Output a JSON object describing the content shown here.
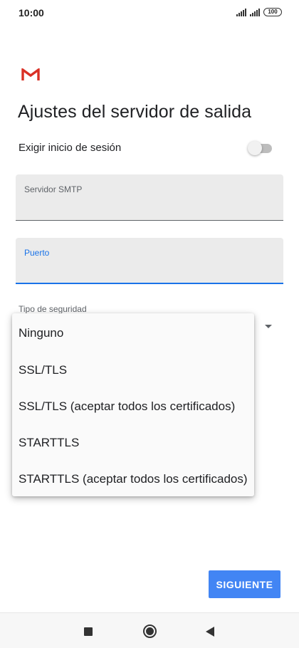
{
  "status_bar": {
    "time": "10:00",
    "battery": "100",
    "icons": [
      "signal-icon",
      "signal-icon",
      "battery-icon"
    ]
  },
  "header": {
    "logo": "gmail-logo",
    "title": "Ajustes del servidor de salida"
  },
  "form": {
    "require_login_label": "Exigir inicio de sesión",
    "require_login_enabled": false,
    "smtp_field": {
      "label": "Servidor SMTP",
      "value": ""
    },
    "port_field": {
      "label": "Puerto",
      "value": ""
    },
    "security_label": "Tipo de seguridad"
  },
  "security_dropdown": {
    "options": [
      "Ninguno",
      "SSL/TLS",
      "SSL/TLS (aceptar todos los certificados)",
      "STARTTLS",
      "STARTTLS (aceptar todos los certificados)"
    ]
  },
  "actions": {
    "next_label": "SIGUIENTE"
  },
  "colors": {
    "accent": "#1a73e8",
    "button": "#4285f4",
    "gmail_red": "#d93025"
  },
  "nav_bar": {
    "icons": [
      "recent-apps-icon",
      "home-icon",
      "back-icon"
    ]
  }
}
